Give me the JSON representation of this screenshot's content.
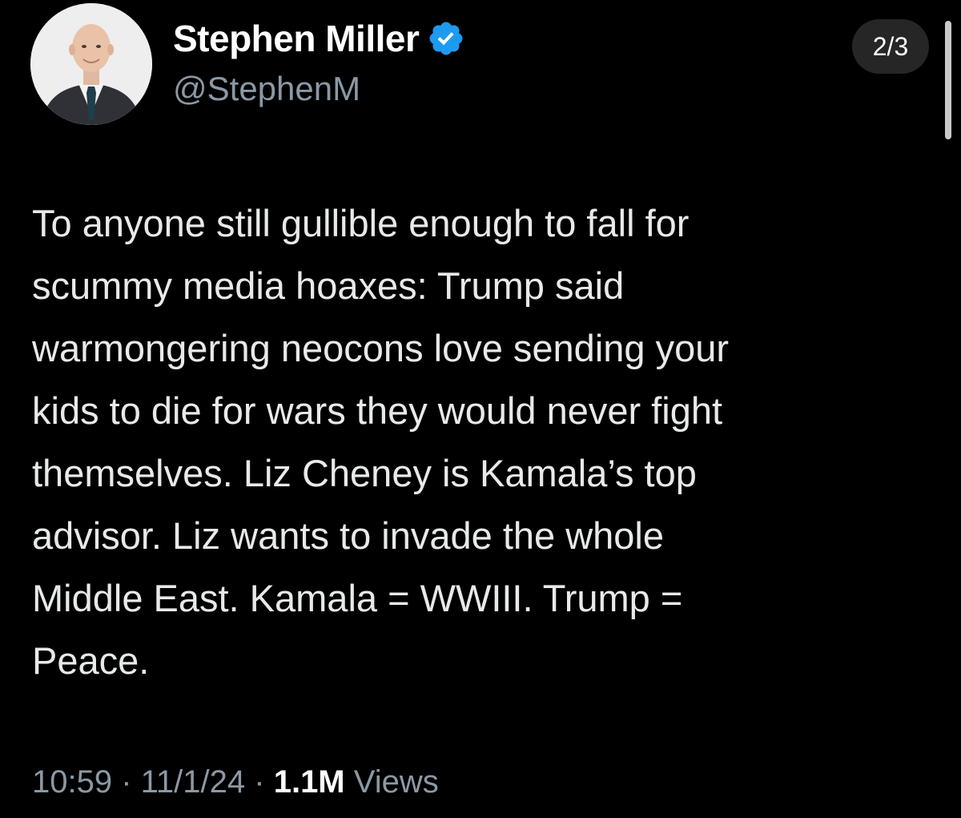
{
  "tweet": {
    "author": {
      "display_name": "Stephen Miller",
      "handle": "@StephenM",
      "avatar_icon": "profile-photo-icon",
      "verified_icon": "verified-badge-icon",
      "verified_color": "#1d9bf0"
    },
    "page_indicator": "2/3",
    "text": "To anyone still gullible enough to fall for\nscummy media hoaxes: Trump said\nwarmongering neocons love sending your\nkids to die for wars they would never fight\nthemselves. Liz Cheney is Kamala’s top\nadvisor. Liz wants to invade the whole\nMiddle East. Kamala = WWIII. Trump =\nPeace.",
    "meta": {
      "time": "10:59",
      "date": "11/1/24",
      "views_count": "1.1M",
      "views_label": "Views",
      "separator": " · "
    }
  },
  "colors": {
    "background": "#000000",
    "text_primary": "#e7e9ea",
    "text_secondary": "#8b98a5",
    "accent": "#1d9bf0"
  }
}
